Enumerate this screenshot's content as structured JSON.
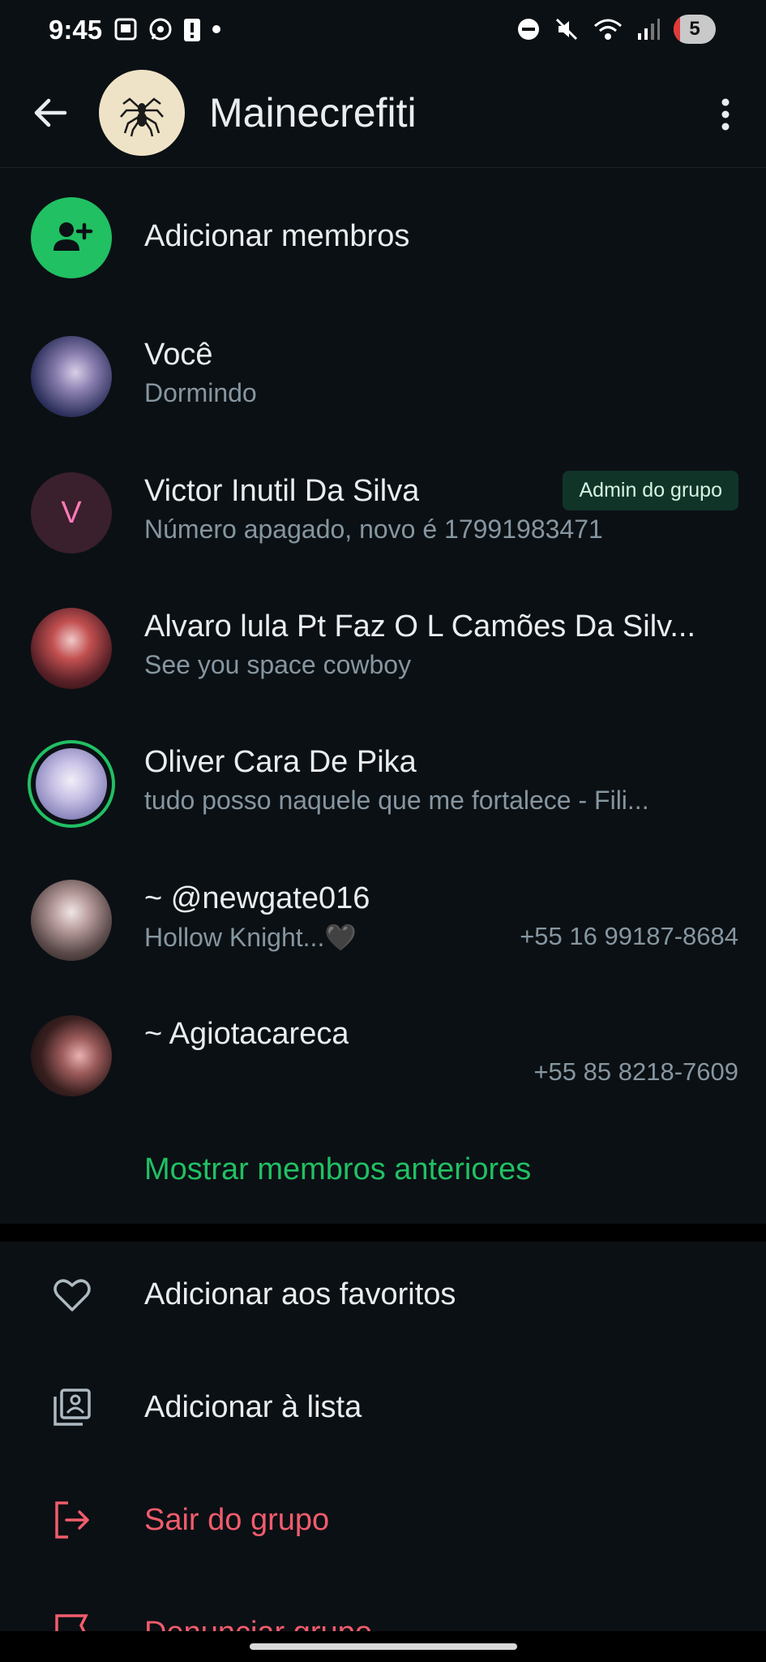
{
  "status_bar": {
    "time": "9:45",
    "icons_left": [
      "screenshot-icon",
      "whatsapp-icon",
      "alert-icon",
      "dot-icon"
    ],
    "icons_right": [
      "dnd-icon",
      "mute-icon",
      "wifi-icon",
      "signal-icon"
    ],
    "battery": "5"
  },
  "header": {
    "title": "Mainecrefiti",
    "back_icon": "arrow-back-icon",
    "menu_icon": "more-vert-icon"
  },
  "members": {
    "add_members_label": "Adicionar membros",
    "list": [
      {
        "name": "Você",
        "status": "Dormindo",
        "phone": "",
        "badge": "",
        "avatar_color": "#2b2f5a"
      },
      {
        "name": "Victor Inutil Da Silva",
        "status": "Número apagado, novo é 17991983471",
        "phone": "",
        "badge": "Admin do grupo",
        "avatar_letter": "V",
        "avatar_color": "#3a1f2c"
      },
      {
        "name": "Alvaro lula Pt Faz O L Camões Da Silv...",
        "status": "See you space cowboy",
        "phone": "",
        "badge": "",
        "avatar_color": "#5a2128"
      },
      {
        "name": "Oliver Cara De Pika",
        "status": "tudo posso naquele que me fortalece   - Fili...",
        "phone": "",
        "badge": "",
        "avatar_color": "#8f8bbf"
      },
      {
        "name": "~ @newgate016",
        "status": "Hollow Knight...🖤",
        "phone": "+55 16 99187-8684",
        "badge": "",
        "avatar_color": "#5b4a4a"
      },
      {
        "name": "~ Agiotacareca",
        "status": "",
        "phone": "+55 85 8218-7609",
        "badge": "",
        "avatar_color": "#3a2020"
      }
    ],
    "show_previous_label": "Mostrar membros anteriores"
  },
  "actions": [
    {
      "label": "Adicionar aos favoritos",
      "icon": "heart-icon",
      "danger": false
    },
    {
      "label": "Adicionar à lista",
      "icon": "list-icon",
      "danger": false
    },
    {
      "label": "Sair do grupo",
      "icon": "exit-icon",
      "danger": true
    },
    {
      "label": "Denunciar grupo",
      "icon": "report-icon",
      "danger": true
    }
  ],
  "colors": {
    "background": "#0b1014",
    "accent_green": "#21c063",
    "danger_red": "#f15c6d",
    "secondary_text": "#8696a0"
  }
}
